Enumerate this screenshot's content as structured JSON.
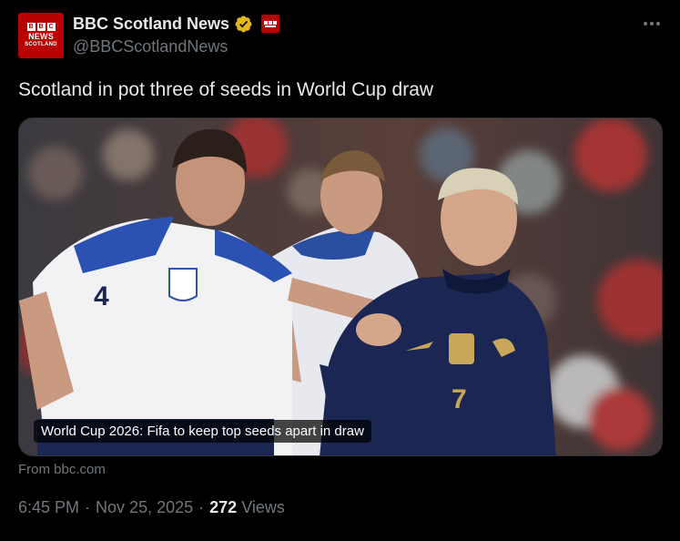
{
  "account": {
    "avatar": {
      "blocks": [
        "B",
        "B",
        "C"
      ],
      "line1": "NEWS",
      "line2": "SCOTLAND"
    },
    "display_name": "BBC Scotland News",
    "handle": "@BBCScotlandNews"
  },
  "tweet": {
    "text": "Scotland in pot three of seeds in World Cup draw",
    "card": {
      "caption": "World Cup 2026: Fifa to keep top seeds apart in draw",
      "source": "From bbc.com"
    },
    "time": "6:45 PM",
    "separator": "·",
    "date": "Nov 25, 2025",
    "views_count": "272",
    "views_label": "Views"
  },
  "colors": {
    "background": "#000000",
    "text_primary": "#e7e9ea",
    "text_secondary": "#71767b",
    "verified_gold": "#e2b719",
    "bbc_red": "#b80000",
    "england_white": "#f2f2f4",
    "france_navy": "#1b2752"
  },
  "icons": {
    "verified": "verified-gold-badge-icon",
    "affiliation": "bbc-affiliate-badge-icon",
    "more": "more-horizontal-icon"
  },
  "photo_text": {
    "england_number": "4",
    "france_number": "7"
  }
}
